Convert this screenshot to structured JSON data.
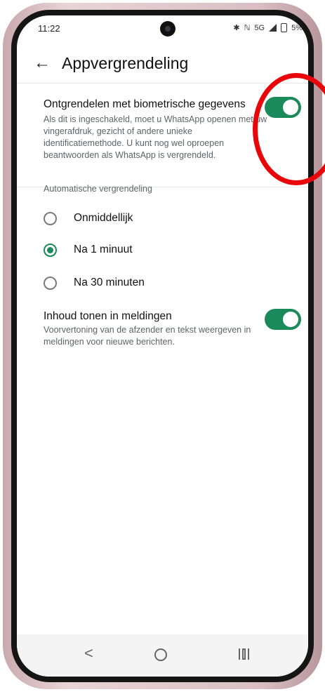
{
  "status_bar": {
    "time": "11:22",
    "network": "5G",
    "battery_percent": "5%",
    "icons": [
      "bluetooth-icon",
      "mute-icon",
      "signal-icon",
      "battery-icon"
    ]
  },
  "header": {
    "back_icon": "back-arrow-icon",
    "title": "Appvergrendeling"
  },
  "biometric": {
    "title": "Ontgrendelen met biometrische gegevens",
    "description": "Als dit is ingeschakeld, moet u WhatsApp openen met uw vingerafdruk, gezicht of andere unieke identificatiemethode. U kunt nog wel oproepen beantwoorden als WhatsApp is vergrendeld.",
    "enabled": true
  },
  "auto_lock": {
    "label": "Automatische vergrendeling",
    "options": [
      {
        "label": "Onmiddellijk",
        "selected": false
      },
      {
        "label": "Na 1 minuut",
        "selected": true
      },
      {
        "label": "Na 30 minuten",
        "selected": false
      }
    ]
  },
  "notifications": {
    "title": "Inhoud tonen in meldingen",
    "description": "Voorvertoning van de afzender en tekst weergeven in meldingen voor nieuwe berichten.",
    "enabled": true
  },
  "nav": {
    "icons": [
      "back-icon",
      "home-icon",
      "recent-apps-icon"
    ]
  },
  "colors": {
    "accent": "#1b8a5a",
    "annotation": "#e8060a"
  }
}
